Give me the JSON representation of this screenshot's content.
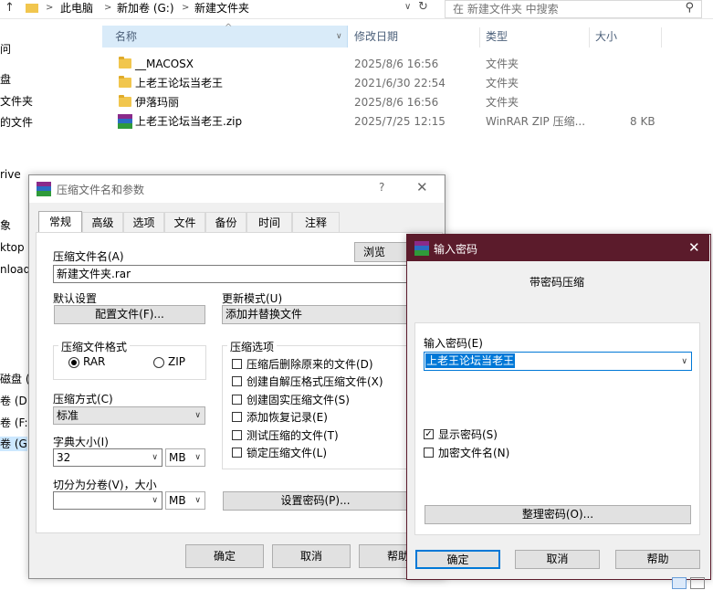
{
  "explorer": {
    "breadcrumb": [
      "此电脑",
      "新加卷 (G:)",
      "新建文件夹"
    ],
    "search_placeholder": "在 新建文件夹 中搜索",
    "columns": {
      "name": "名称",
      "date": "修改日期",
      "type": "类型",
      "size": "大小"
    },
    "files": [
      {
        "name": "__MACOSX",
        "date": "2025/8/6 16:56",
        "type": "文件夹",
        "size": "",
        "icon": "folder-icon"
      },
      {
        "name": "上老王论坛当老王",
        "date": "2021/6/30 22:54",
        "type": "文件夹",
        "size": "",
        "icon": "folder-icon"
      },
      {
        "name": "伊落玛丽",
        "date": "2025/8/6 16:56",
        "type": "文件夹",
        "size": "",
        "icon": "folder-icon"
      },
      {
        "name": "上老王论坛当老王.zip",
        "date": "2025/7/25 12:15",
        "type": "WinRAR ZIP 压缩...",
        "size": "8 KB",
        "icon": "winrar-zip-icon"
      }
    ],
    "nav_fragments": [
      "问",
      "盘",
      "文件夹",
      "的文件",
      "rive",
      "象",
      "ktop",
      "nload",
      "磁盘 (C",
      "卷 (D:)",
      "卷 (F:)",
      "卷 (G:)"
    ]
  },
  "archive_dialog": {
    "title": "压缩文件名和参数",
    "help_glyph": "?",
    "tabs": [
      "常规",
      "高级",
      "选项",
      "文件",
      "备份",
      "时间",
      "注释"
    ],
    "archive_name_label": "压缩文件名(A)",
    "archive_name_value": "新建文件夹.rar",
    "browse_label": "浏览(B)...",
    "default_settings_label": "默认设置",
    "profiles_button": "配置文件(F)...",
    "update_mode_label": "更新模式(U)",
    "update_mode_value": "添加并替换文件",
    "format_group_label": "压缩文件格式",
    "format_options": [
      "RAR",
      "ZIP"
    ],
    "format_selected": "RAR",
    "method_label": "压缩方式(C)",
    "method_value": "标准",
    "dict_label": "字典大小(I)",
    "dict_value": "32",
    "dict_unit": "MB",
    "split_label": "切分为分卷(V)，大小",
    "split_value": "",
    "split_unit": "MB",
    "options_group_label": "压缩选项",
    "options": [
      {
        "label": "压缩后删除原来的文件(D)",
        "checked": false
      },
      {
        "label": "创建自解压格式压缩文件(X)",
        "checked": false
      },
      {
        "label": "创建固实压缩文件(S)",
        "checked": false
      },
      {
        "label": "添加恢复记录(E)",
        "checked": false
      },
      {
        "label": "测试压缩的文件(T)",
        "checked": false
      },
      {
        "label": "锁定压缩文件(L)",
        "checked": false
      }
    ],
    "set_password_button": "设置密码(P)...",
    "ok_button": "确定",
    "cancel_button": "取消",
    "help_button": "帮助"
  },
  "password_dialog": {
    "title": "输入密码",
    "subtitle": "带密码压缩",
    "password_label": "输入密码(E)",
    "password_value": "上老王论坛当老王",
    "show_password_label": "显示密码(S)",
    "show_password_checked": true,
    "encrypt_names_label": "加密文件名(N)",
    "encrypt_names_checked": false,
    "organize_button": "整理密码(O)...",
    "ok_button": "确定",
    "cancel_button": "取消",
    "help_button": "帮助"
  },
  "colors": {
    "password_titlebar": "#5b1b2b",
    "selection": "#0078d7",
    "header_hover": "#d9ebf9"
  }
}
